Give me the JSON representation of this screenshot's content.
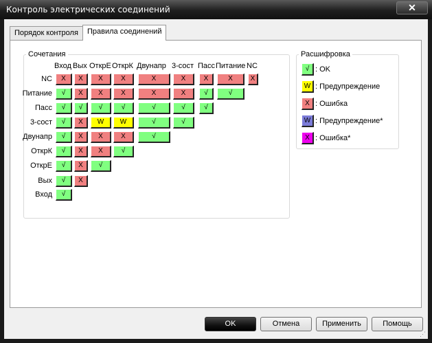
{
  "window": {
    "title": "Контроль электрических соединений",
    "close_glyph": "✕"
  },
  "tabs": [
    "Порядок контроля",
    "Правила соединений"
  ],
  "combinations": {
    "title": "Сочетания",
    "columns": [
      "Вход",
      "Вых",
      "ОткрЕ",
      "ОткрК",
      "Двунапр",
      "3-сост",
      "Пасс",
      "Питание",
      "NC"
    ],
    "rows": [
      {
        "label": "NC",
        "cells": [
          "X",
          "X",
          "X",
          "X",
          "X",
          "X",
          "X",
          "X",
          "X"
        ]
      },
      {
        "label": "Питание",
        "cells": [
          "√",
          "X",
          "X",
          "X",
          "X",
          "X",
          "√",
          "√"
        ]
      },
      {
        "label": "Пасс",
        "cells": [
          "√",
          "√",
          "√",
          "√",
          "√",
          "√",
          "√"
        ]
      },
      {
        "label": "3-сост",
        "cells": [
          "√",
          "X",
          "W",
          "W",
          "√",
          "√"
        ]
      },
      {
        "label": "Двунапр",
        "cells": [
          "√",
          "X",
          "X",
          "X",
          "√"
        ]
      },
      {
        "label": "ОткрК",
        "cells": [
          "√",
          "X",
          "X",
          "√"
        ]
      },
      {
        "label": "ОткрЕ",
        "cells": [
          "√",
          "X",
          "√"
        ]
      },
      {
        "label": "Вых",
        "cells": [
          "√",
          "X"
        ]
      },
      {
        "label": "Вход",
        "cells": [
          "√"
        ]
      }
    ]
  },
  "legend": {
    "title": "Расшифровка",
    "items": [
      {
        "symbol": "√",
        "text": ": OK",
        "kind": "ok"
      },
      {
        "symbol": "W",
        "text": ": Предупреждение",
        "kind": "warn"
      },
      {
        "symbol": "X",
        "text": ": Ошибка",
        "kind": "err"
      },
      {
        "symbol": "W",
        "text": ": Предупреждение*",
        "kind": "warn2"
      },
      {
        "symbol": "X",
        "text": ": Ошибка*",
        "kind": "err2"
      }
    ]
  },
  "buttons": {
    "ok": "OK",
    "cancel": "Отмена",
    "apply": "Применить",
    "help": "Помощь"
  },
  "colors": {
    "ok": "#80ff80",
    "error": "#f08080",
    "warning": "#ffff00",
    "warning_star": "#7b7bd8",
    "error_star": "#ee00ee"
  }
}
